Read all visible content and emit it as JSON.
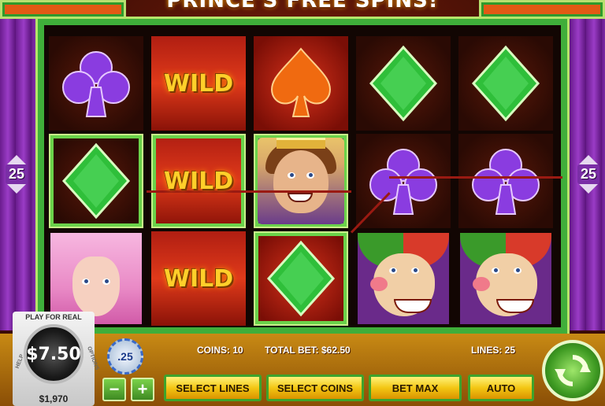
{
  "title": "PRINCE'S FREE SPINS!",
  "lines_indicator": "25",
  "reels": [
    [
      "club",
      "diamond",
      "girl"
    ],
    [
      "wild",
      "wild",
      "wild"
    ],
    [
      "spade",
      "king",
      "diamond"
    ],
    [
      "diamond",
      "club",
      "jester"
    ],
    [
      "diamond",
      "club",
      "jester"
    ]
  ],
  "wild_label": "WILD",
  "info": {
    "coins": "COINS: 10",
    "total_bet": "TOTAL BET: $62.50",
    "lines": "LINES: 25"
  },
  "coin_value": ".25",
  "balance": {
    "play_for_real": "PLAY FOR REAL",
    "amount": "$7.50",
    "credits": "$1,970",
    "help": "HELP",
    "options": "OPTIONS"
  },
  "buttons": {
    "minus": "−",
    "plus": "+",
    "select_lines": "SELECT LINES",
    "select_coins": "SELECT COINS",
    "bet_max": "BET MAX",
    "auto": "AUTO"
  },
  "icons": {
    "spin": "refresh-arrows-icon"
  },
  "colors": {
    "frame_green": "#3fae3a",
    "club_purple": "#8a3ce0",
    "diamond_green": "#2fbf3a",
    "spade_orange": "#f06a10",
    "button_yellow": "#f3c613"
  }
}
